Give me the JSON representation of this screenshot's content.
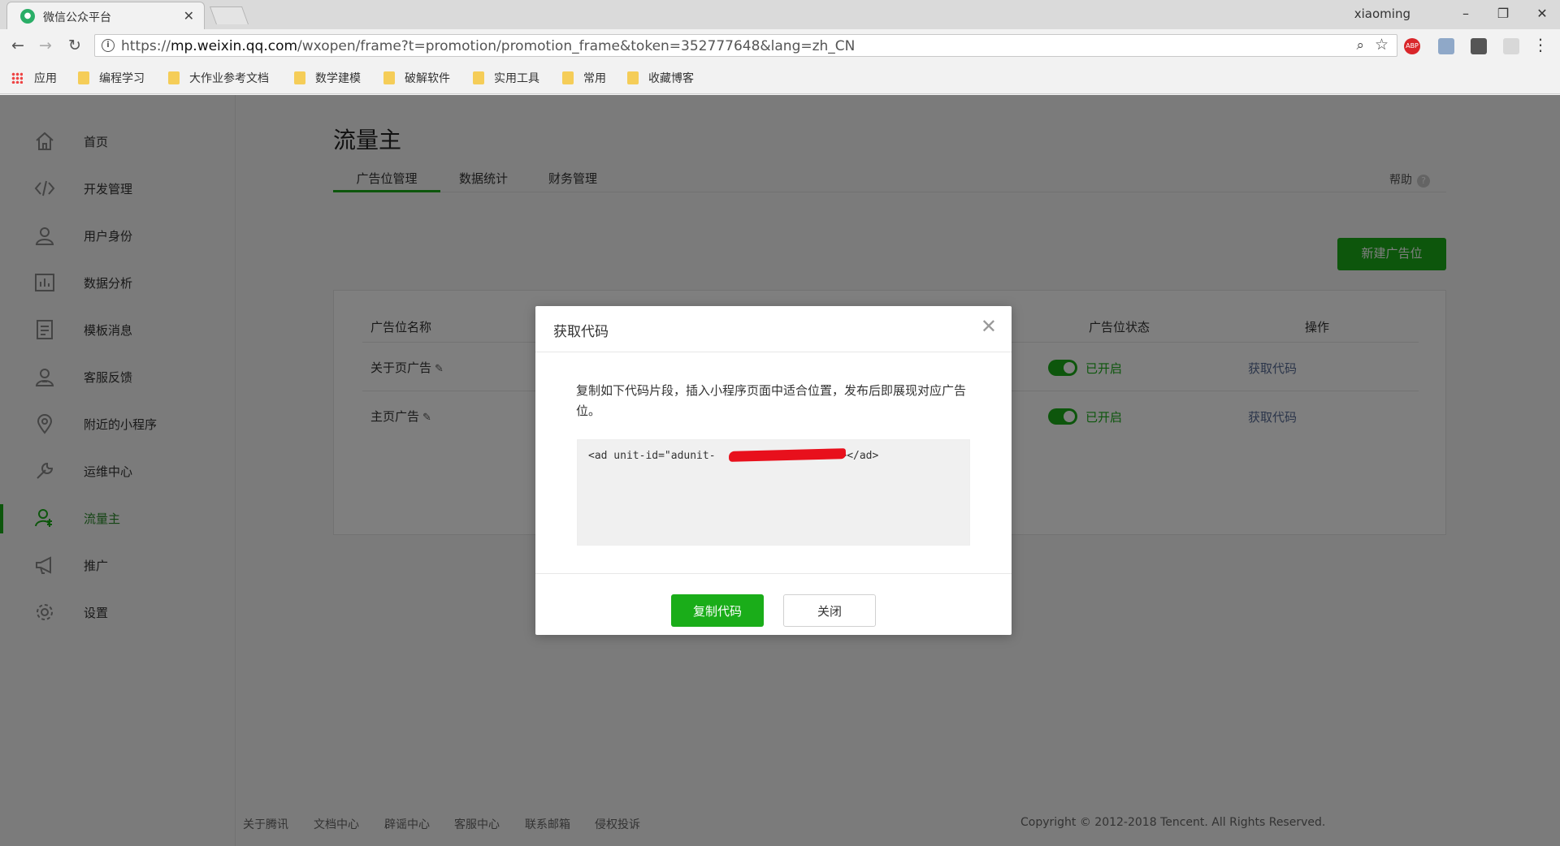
{
  "browser": {
    "tab_title": "微信公众平台",
    "user": "xiaoming",
    "url_prefix": "https://",
    "url_host": "mp.weixin.qq.com",
    "url_path": "/wxopen/frame?t=promotion/promotion_frame&token=352777648&lang=zh_CN",
    "bookmarks": [
      "应用",
      "编程学习",
      "大作业参考文档",
      "数学建模",
      "破解软件",
      "实用工具",
      "常用",
      "收藏博客"
    ]
  },
  "sidebar": {
    "items": [
      {
        "label": "首页",
        "icon": "home-icon"
      },
      {
        "label": "开发管理",
        "icon": "code-icon"
      },
      {
        "label": "用户身份",
        "icon": "user-icon"
      },
      {
        "label": "数据分析",
        "icon": "chart-icon"
      },
      {
        "label": "模板消息",
        "icon": "document-icon"
      },
      {
        "label": "客服反馈",
        "icon": "support-icon"
      },
      {
        "label": "附近的小程序",
        "icon": "location-icon"
      },
      {
        "label": "运维中心",
        "icon": "wrench-icon"
      },
      {
        "label": "流量主",
        "icon": "user-dollar-icon",
        "active": true
      },
      {
        "label": "推广",
        "icon": "megaphone-icon"
      },
      {
        "label": "设置",
        "icon": "gear-icon"
      }
    ]
  },
  "main": {
    "title": "流量主",
    "tabs": [
      "广告位管理",
      "数据统计",
      "财务管理"
    ],
    "help": "帮助",
    "new_button": "新建广告位",
    "table": {
      "headers": [
        "广告位名称",
        "广告位状态",
        "操作"
      ],
      "rows": [
        {
          "name": "关于页广告",
          "status": "已开启",
          "action": "获取代码"
        },
        {
          "name": "主页广告",
          "status": "已开启",
          "action": "获取代码"
        }
      ]
    }
  },
  "footer": {
    "links": [
      "关于腾讯",
      "文档中心",
      "辟谣中心",
      "客服中心",
      "联系邮箱",
      "侵权投诉"
    ],
    "copyright": "Copyright © 2012-2018 Tencent. All Rights Reserved."
  },
  "dialog": {
    "title": "获取代码",
    "description": "复制如下代码片段，插入小程序页面中适合位置，发布后即展现对应广告位。",
    "code_start": "<ad unit-id=\"adunit-",
    "code_end": "\"></ad>",
    "copy_button": "复制代码",
    "close_button": "关闭"
  },
  "colors": {
    "accent": "#1aad19",
    "link": "#576b95",
    "redaction": "#e8101c"
  }
}
